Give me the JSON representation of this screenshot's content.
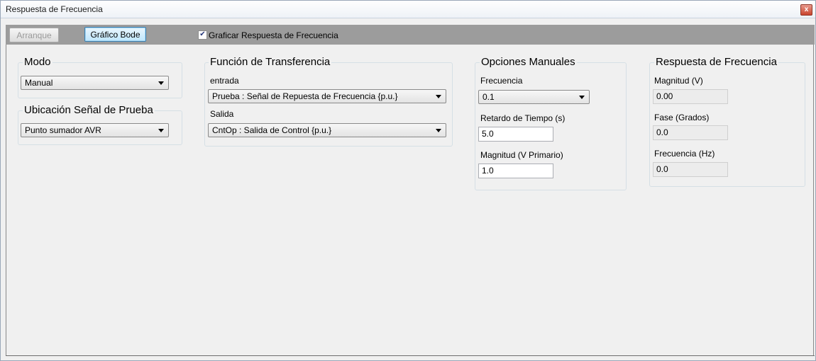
{
  "window": {
    "title": "Respuesta de Frecuencia",
    "close_glyph": "x"
  },
  "toolbar": {
    "start_label": "Arranque",
    "bode_label": "Gráfico Bode",
    "plot_checkbox_checked": true,
    "plot_checkbox_label": "Graficar Respuesta de Frecuencia"
  },
  "modo": {
    "title": "Modo",
    "value": "Manual"
  },
  "ubicacion": {
    "title": "Ubicación Señal de Prueba",
    "value": "Punto sumador AVR"
  },
  "funcion": {
    "title": "Función de Transferencia",
    "input_label": "entrada",
    "input_value": "Prueba : Señal de Repuesta de Frecuencia {p.u.}",
    "output_label": "Salida",
    "output_value": "CntOp : Salida de Control {p.u.}"
  },
  "opciones": {
    "title": "Opciones Manuales",
    "freq_label": "Frecuencia",
    "freq_value": "0.1",
    "delay_label": "Retardo de Tiempo (s)",
    "delay_value": "5.0",
    "mag_label": "Magnitud (V Primario)",
    "mag_value": "1.0"
  },
  "respuesta": {
    "title": "Respuesta de Frecuencia",
    "mag_label": "Magnitud (V)",
    "mag_value": "0.00",
    "phase_label": "Fase (Grados)",
    "phase_value": "0.0",
    "freq_label": "Frecuencia (Hz)",
    "freq_value": "0.0"
  },
  "colors": {
    "toolbar_bg": "#9c9c9c",
    "window_bg": "#f0f0f0",
    "focus_border": "#3c7fb1"
  }
}
